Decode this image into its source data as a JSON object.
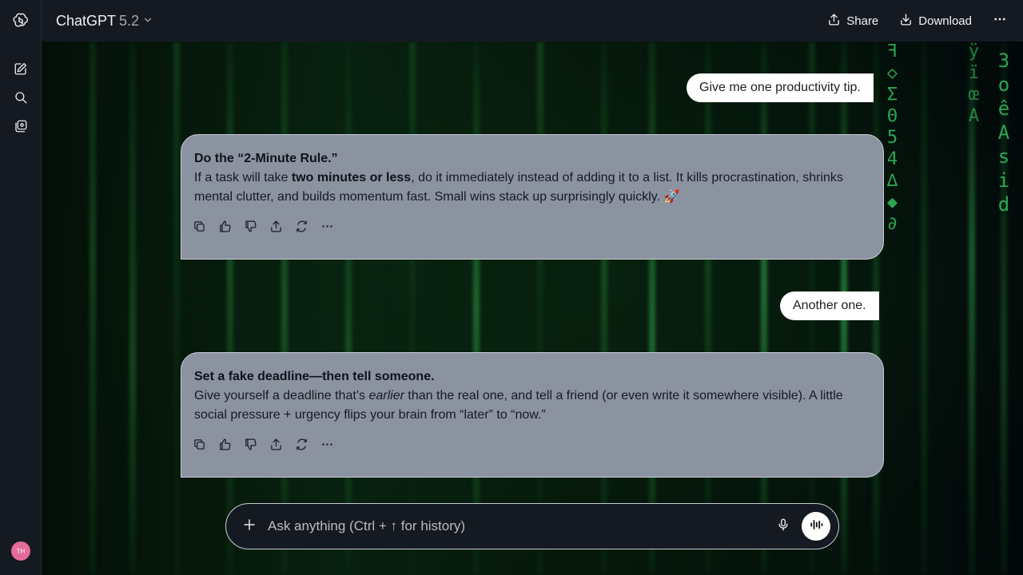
{
  "app": {
    "model_name": "ChatGPT",
    "model_version": "5.2"
  },
  "header": {
    "share_label": "Share",
    "download_label": "Download"
  },
  "sidebar": {
    "avatar_initials": "TH"
  },
  "conversation": {
    "messages": [
      {
        "role": "user",
        "text": "Give me one productivity tip."
      },
      {
        "role": "assistant",
        "title": "Do the “2-Minute Rule.”",
        "body_pre": "If a task will take ",
        "body_bold": "two minutes or less",
        "body_post": ", do it immediately instead of adding it to a list. It kills procrastination, shrinks mental clutter, and builds momentum fast. Small wins stack up surprisingly quickly. 🚀"
      },
      {
        "role": "user",
        "text": "Another one."
      },
      {
        "role": "assistant",
        "title": "Set a fake deadline—then tell someone.",
        "body_pre": "Give yourself a deadline that’s ",
        "body_italic": "earlier",
        "body_post": " than the real one, and tell a friend (or even write it somewhere visible). A little social pressure + urgency flips your brain from “later” to “now.”"
      }
    ]
  },
  "composer": {
    "placeholder": "Ask anything (Ctrl + ↑ for history)"
  },
  "colors": {
    "sidebar_bg": "#151a22",
    "answer_bg": "#8b93a1",
    "user_bubble_bg": "#ffffff",
    "avatar_bg": "#e56b9a",
    "matrix_green": "#3bd56a"
  }
}
